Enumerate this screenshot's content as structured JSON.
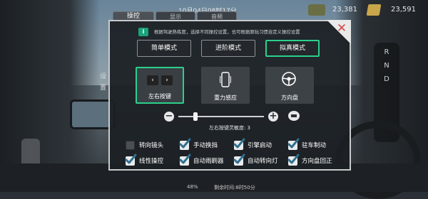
{
  "statusbar": {
    "datetime": "10月04日08时17分",
    "money_1": "23,381",
    "money_2": "23,591"
  },
  "tabs": [
    {
      "label": "操控",
      "active": true
    },
    {
      "label": "显示",
      "active": false
    },
    {
      "label": "音频",
      "active": false
    }
  ],
  "side_label": "设置",
  "info": {
    "badge": "i",
    "text": "根据驾驶熟练度，选择不同操控设置，也可根据原玩习惯自定义操控设置"
  },
  "modes": [
    {
      "label": "简单模式",
      "active": false
    },
    {
      "label": "进阶模式",
      "active": false
    },
    {
      "label": "拟真模式",
      "active": true
    }
  ],
  "controls": [
    {
      "label": "左右按键",
      "icon": "left-right-arrows-icon",
      "active": true
    },
    {
      "label": "重力感应",
      "icon": "phone-tilt-icon",
      "active": false
    },
    {
      "label": "方向盘",
      "icon": "steering-wheel-icon",
      "active": false
    }
  ],
  "sensitivity": {
    "label": "左右按键灵敏度: 3",
    "value": 3,
    "fraction": 0.2
  },
  "options": [
    {
      "label": "转向镜头",
      "checked": false
    },
    {
      "label": "手动换挡",
      "checked": true
    },
    {
      "label": "引擎启动",
      "checked": true
    },
    {
      "label": "驻车制动",
      "checked": true
    },
    {
      "label": "线性操控",
      "checked": true
    },
    {
      "label": "自动雨刷器",
      "checked": true
    },
    {
      "label": "自动转向灯",
      "checked": true
    },
    {
      "label": "方向盘回正",
      "checked": true
    }
  ],
  "bottombar": {
    "item_1": "48%",
    "item_2": "剩余时间:8时50分"
  },
  "gearbox": [
    "R",
    "N",
    "D"
  ],
  "colors": {
    "accent": "#2bd08c",
    "close": "#d64848"
  }
}
